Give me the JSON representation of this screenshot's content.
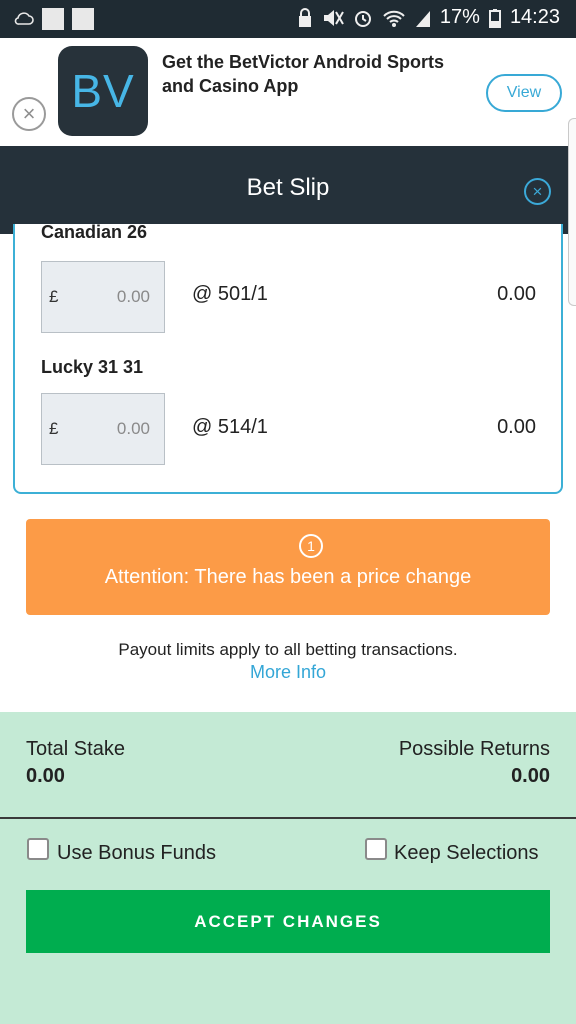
{
  "status_bar": {
    "battery": "17%",
    "time": "14:23"
  },
  "banner": {
    "logo_text": "BV",
    "title": "Get the BetVictor Android Sports and Casino App",
    "view_label": "View"
  },
  "header": {
    "title": "Bet Slip"
  },
  "bets": [
    {
      "name": "Canadian 26",
      "currency": "£",
      "stake_placeholder": "0.00",
      "odds": "@ 501/1",
      "returns": "0.00"
    },
    {
      "name": "Lucky 31 31",
      "currency": "£",
      "stake_placeholder": "0.00",
      "odds": "@ 514/1",
      "returns": "0.00"
    }
  ],
  "attention": {
    "icon_text": "1",
    "message": "Attention: There has been a price change"
  },
  "payout": {
    "text": "Payout limits apply to all betting transactions.",
    "link": "More Info"
  },
  "footer": {
    "total_stake_label": "Total Stake",
    "total_stake_value": "0.00",
    "possible_returns_label": "Possible Returns",
    "possible_returns_value": "0.00",
    "bonus_funds_label": "Use Bonus Funds",
    "keep_selections_label": "Keep Selections",
    "accept_label": "ACCEPT CHANGES"
  },
  "colors": {
    "header_bg": "#25313a",
    "accent_blue": "#3ba9d8",
    "attention_orange": "#fc9b47",
    "footer_green": "#c4ead5",
    "accept_green": "#00ad4f"
  }
}
